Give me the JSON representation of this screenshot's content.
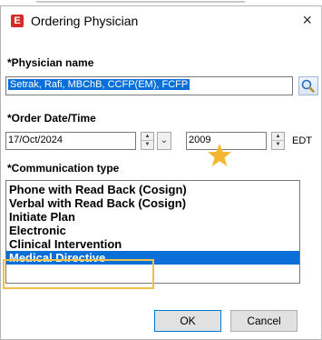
{
  "dialog": {
    "title": "Ordering Physician",
    "app_icon_letter": "E",
    "close_glyph": "×"
  },
  "physician": {
    "label": "*Physician name",
    "value": "Setrak, Rafi, MBChB, CCFP(EM), FCFP"
  },
  "order": {
    "label": "*Order Date/Time",
    "date": "17/Oct/2024",
    "time": "2009",
    "timezone": "EDT",
    "dropdown_glyph": "⌄"
  },
  "communication": {
    "label": "*Communication type",
    "options": [
      "Phone with Read Back (Cosign)",
      "Verbal with Read Back (Cosign)",
      "Initiate Plan",
      "Electronic",
      "Clinical Intervention",
      "Medical Directive"
    ],
    "selected": "Medical Directive"
  },
  "buttons": {
    "ok": "OK",
    "cancel": "Cancel"
  },
  "colors": {
    "selection": "#0a6fd6",
    "highlight": "#f0bf4c",
    "star": "#f5b731",
    "app_icon": "#d62b2b"
  }
}
